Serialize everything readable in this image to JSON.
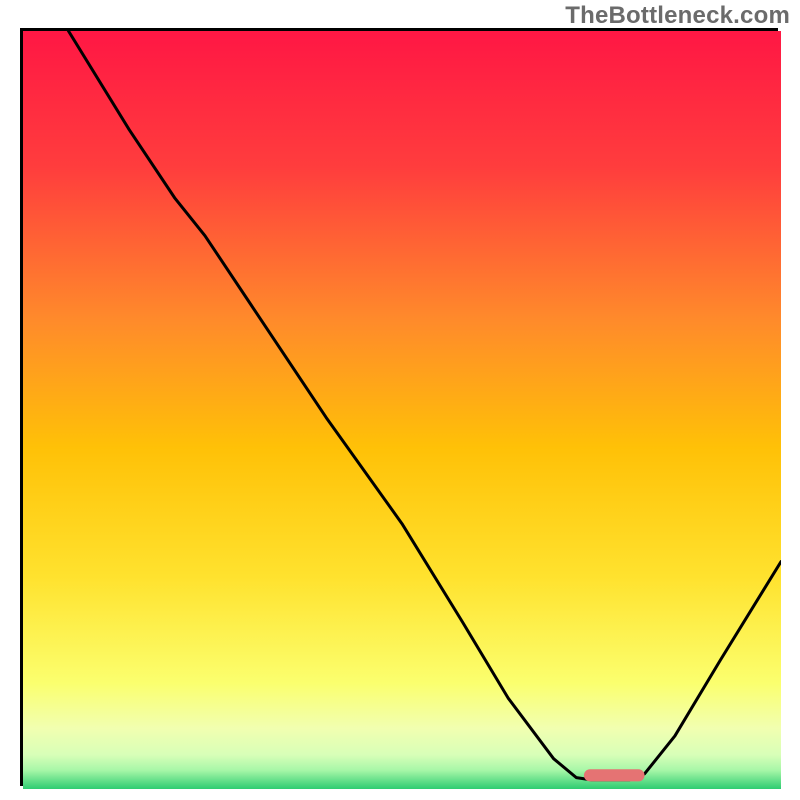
{
  "watermark": "TheBottleneck.com",
  "chart_data": {
    "type": "line",
    "title": "",
    "xlabel": "",
    "ylabel": "",
    "xlim": [
      0,
      100
    ],
    "ylim": [
      0,
      100
    ],
    "gradient_stops": [
      {
        "offset": 0.0,
        "color": "#ff1744"
      },
      {
        "offset": 0.18,
        "color": "#ff3d3d"
      },
      {
        "offset": 0.38,
        "color": "#ff8a2b"
      },
      {
        "offset": 0.55,
        "color": "#ffc107"
      },
      {
        "offset": 0.72,
        "color": "#ffe22e"
      },
      {
        "offset": 0.86,
        "color": "#fbff6e"
      },
      {
        "offset": 0.92,
        "color": "#f1ffb0"
      },
      {
        "offset": 0.955,
        "color": "#d8ffb8"
      },
      {
        "offset": 0.975,
        "color": "#a8f7a8"
      },
      {
        "offset": 1.0,
        "color": "#2ecc71"
      }
    ],
    "curve_points": [
      {
        "x": 6.0,
        "y": 100.0
      },
      {
        "x": 14.0,
        "y": 87.0
      },
      {
        "x": 20.0,
        "y": 78.0
      },
      {
        "x": 24.0,
        "y": 73.0
      },
      {
        "x": 30.0,
        "y": 64.0
      },
      {
        "x": 40.0,
        "y": 49.0
      },
      {
        "x": 50.0,
        "y": 35.0
      },
      {
        "x": 58.0,
        "y": 22.0
      },
      {
        "x": 64.0,
        "y": 12.0
      },
      {
        "x": 70.0,
        "y": 4.0
      },
      {
        "x": 73.0,
        "y": 1.5
      },
      {
        "x": 75.0,
        "y": 1.2
      },
      {
        "x": 80.0,
        "y": 1.2
      },
      {
        "x": 82.0,
        "y": 2.0
      },
      {
        "x": 86.0,
        "y": 7.0
      },
      {
        "x": 92.0,
        "y": 17.0
      },
      {
        "x": 100.0,
        "y": 30.0
      }
    ],
    "marker": {
      "x_start": 74.0,
      "x_end": 82.0,
      "y": 1.8,
      "color": "#e57373",
      "thickness": 1.6
    }
  }
}
